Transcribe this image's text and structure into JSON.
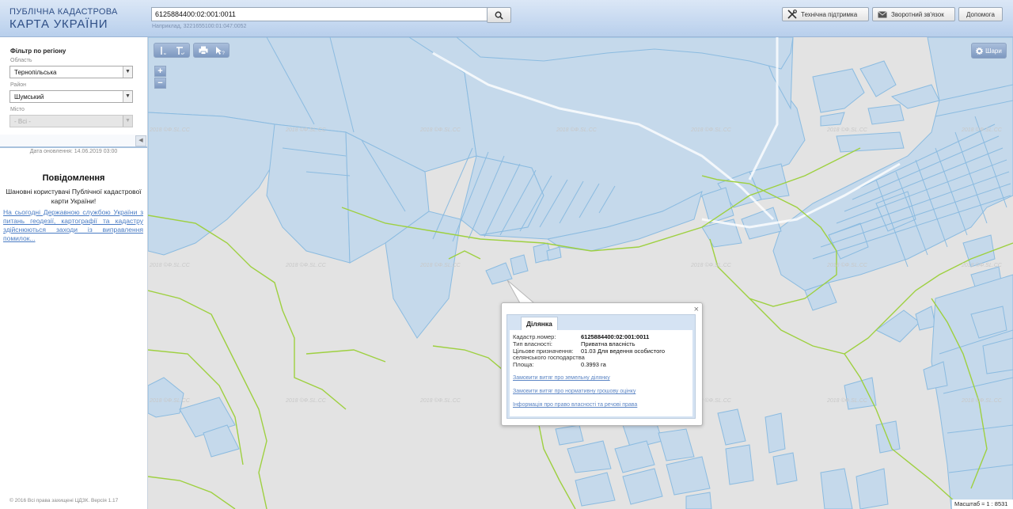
{
  "header": {
    "logo_line1": "ПУБЛІЧНА КАДАСТРОВА",
    "logo_line2": "КАРТА УКРАЇНИ",
    "search_value": "6125884400:02:001:0011",
    "search_hint": "Наприклад, 3221655100:01:047:0052",
    "support_label": "Технічна підтримка",
    "feedback_label": "Зворотний зв'язок",
    "help_label": "Допомога"
  },
  "sidebar": {
    "filter_title": "Фільтр по регіону",
    "region_label": "Область",
    "region_value": "Тернопільська",
    "district_label": "Район",
    "district_value": "Шумський",
    "city_label": "Місто",
    "city_value": "- Всі -",
    "update_date": "Дата оновлення: 14.06.2019 03:00",
    "notice_title": "Повідомлення",
    "notice_text": "Шановні користувачі Публічної кадастрової карти України!",
    "notice_link": "На сьогодні Державною службою України з питань геодезії, картографії та кадастру здійснюються заходи із виправлення помилок...",
    "copyright": "© 2016 Всі права захищені ЦДЗК. Версія 1.17"
  },
  "map": {
    "watermark": "2018 ©Ф.SL.CC",
    "layers_label": "Шари",
    "zoom_in": "+",
    "zoom_out": "−",
    "scale_text": "Масштаб ≈ 1 : 8531"
  },
  "popup": {
    "tab_label": "Ділянка",
    "cad_label": "Кадастр.номер:",
    "cad_value": "6125884400:02:001:0011",
    "owner_label": "Тип власності:",
    "owner_value": "Приватна власність",
    "purpose_label": "Цільове призначення:",
    "purpose_value_line1": "01.03 Для ведення особистого",
    "purpose_value_line2": "селянського господарства",
    "area_label": "Площа:",
    "area_value": "0.3993 га",
    "link1": "Замовити витяг про земельну ділянку",
    "link2": "Замовити витяг про нормативну грошову оцінку",
    "link3": "Інформація про право власності та речові права",
    "close": "×"
  },
  "colors": {
    "parcel_fill": "#c5d9eb",
    "parcel_stroke": "#8bbbe0",
    "boundary": "#9ed040",
    "map_bg": "#e3e3e3"
  }
}
